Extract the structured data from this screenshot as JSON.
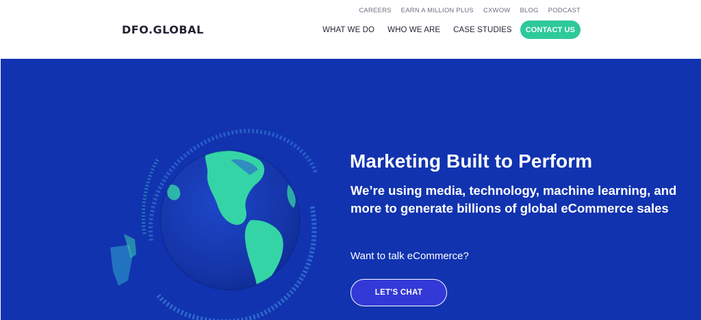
{
  "header": {
    "logo": "DFO.GLOBAL",
    "top_links": [
      "CAREERS",
      "EARN A MILLION PLUS",
      "CXWOW",
      "BLOG",
      "PODCAST"
    ],
    "main_links": [
      "WHAT WE DO",
      "WHO WE ARE",
      "CASE STUDIES"
    ],
    "contact_label": "CONTACT US"
  },
  "hero": {
    "title": "Marketing Built to Perform",
    "subtitle": "We’re using media, technology, machine learning, and more to generate billions of global eCommerce sales",
    "question": "Want to talk eCommerce?",
    "cta_label": "LET'S CHAT"
  },
  "colors": {
    "hero_bg": "#1133b0",
    "accent_green": "#2ec99a",
    "cta_bg": "#3339d6",
    "globe_ocean": "#1a3fb8",
    "globe_land": "#35d4a6"
  },
  "icons": {
    "globe": "globe-illustration"
  }
}
